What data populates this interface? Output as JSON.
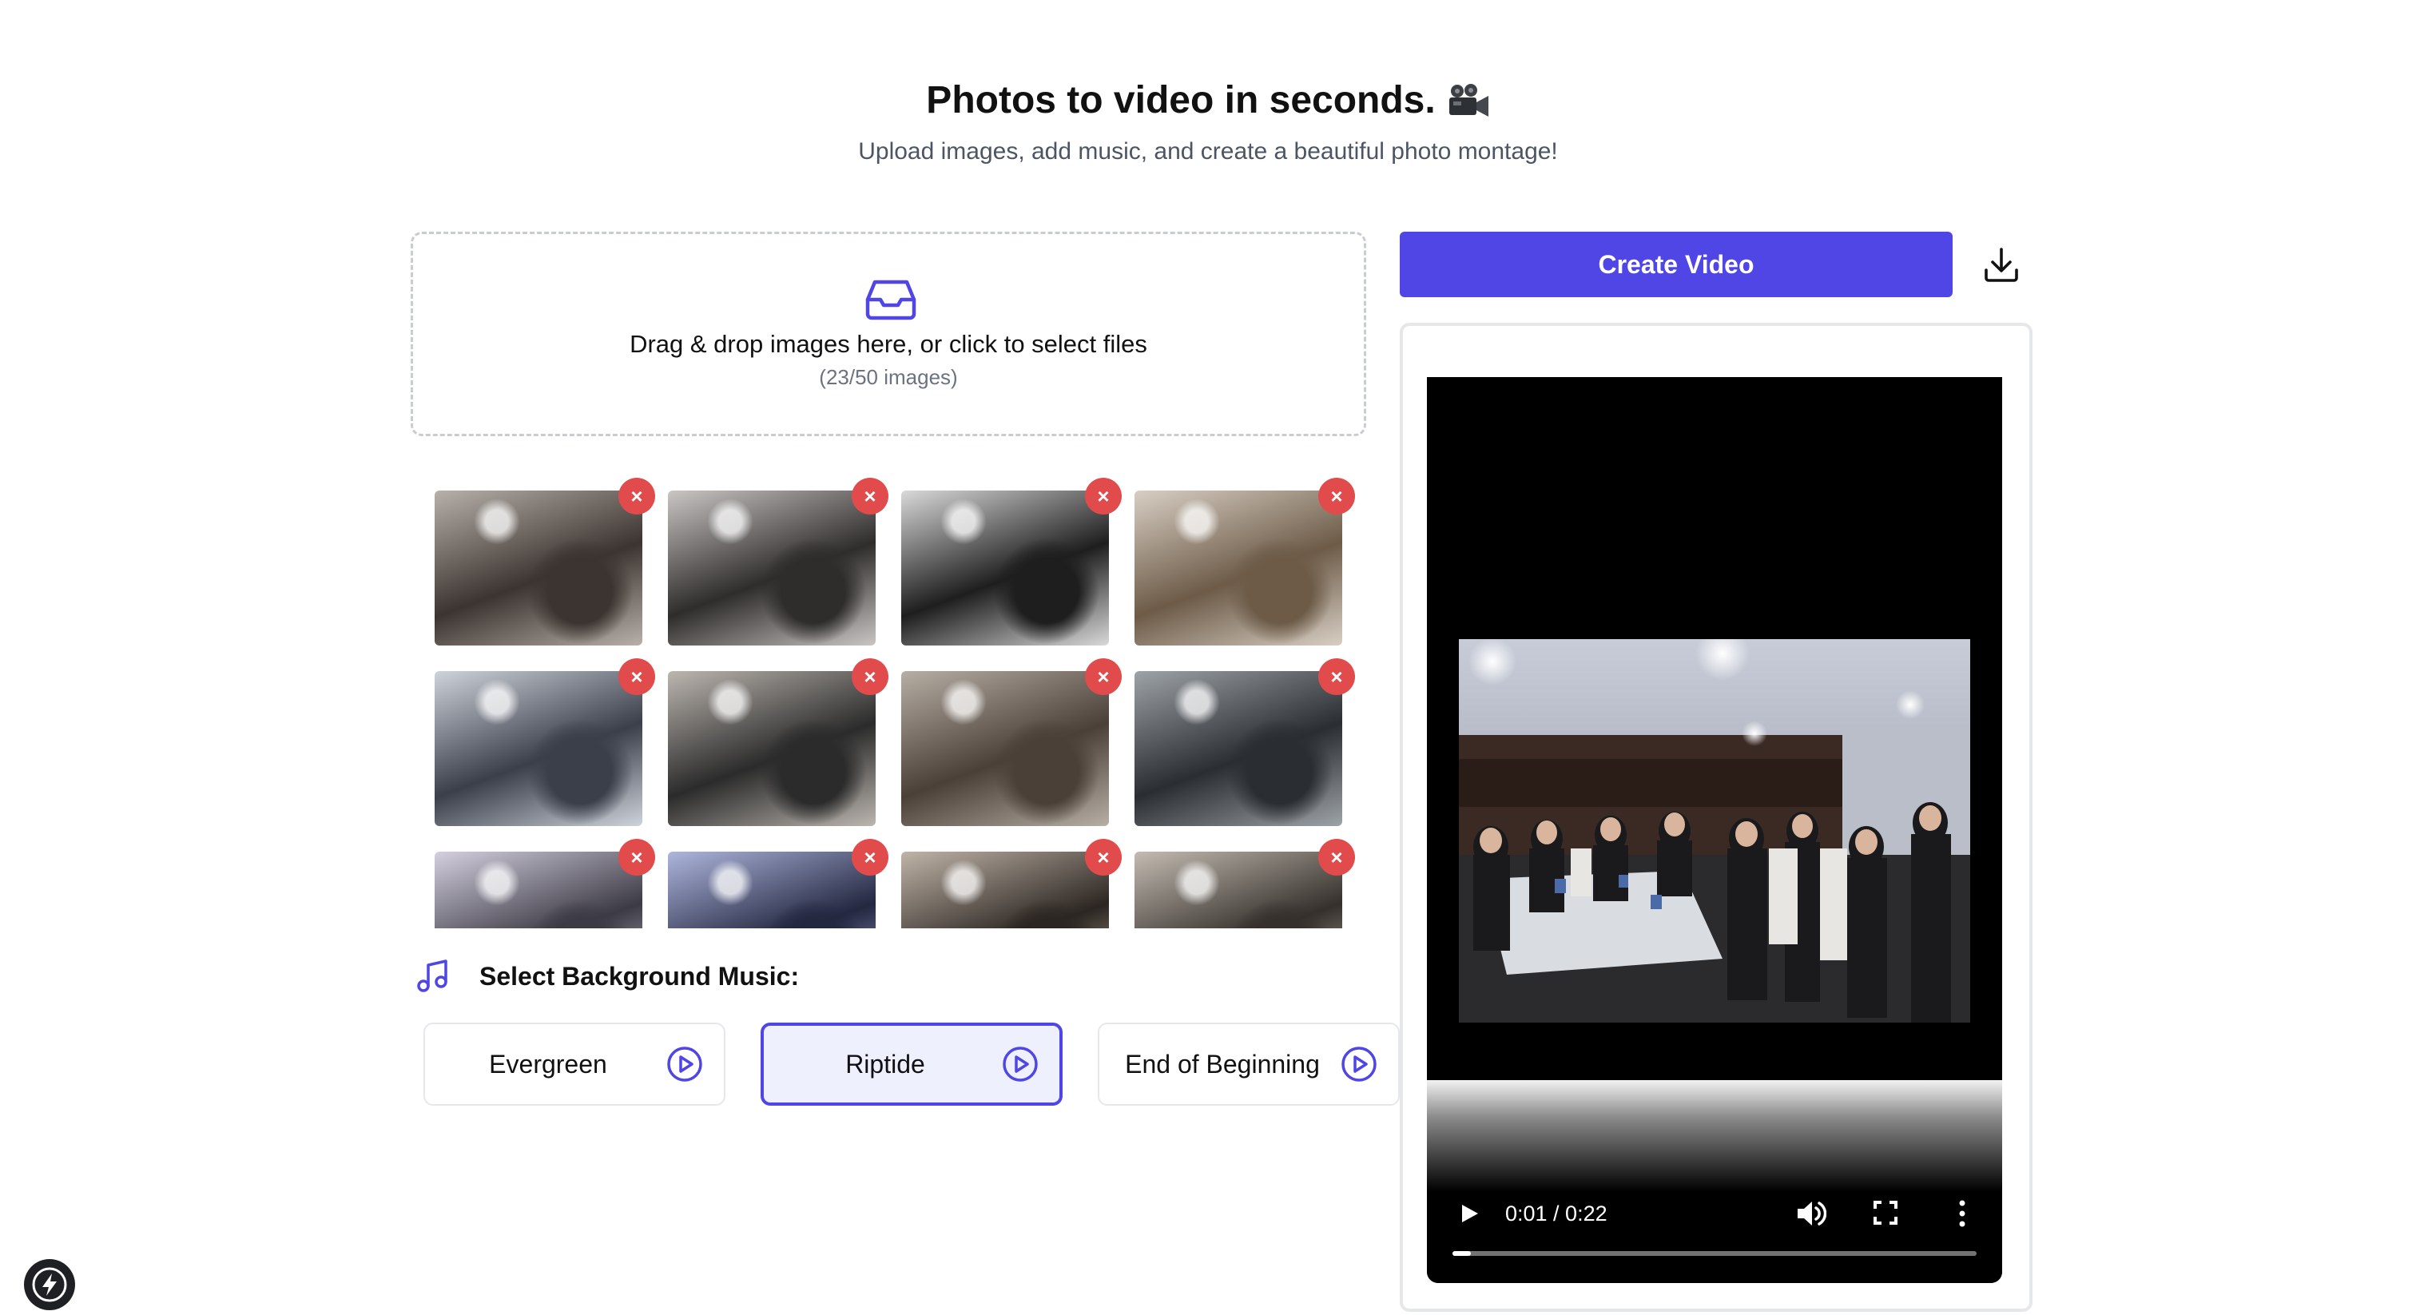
{
  "header": {
    "title": "Photos to video in seconds.",
    "title_icon": "movie-camera-icon",
    "subtitle": "Upload images, add music, and create a beautiful photo montage!"
  },
  "dropzone": {
    "text": "Drag & drop images here, or click to select files",
    "count": "(23/50 images)",
    "icon": "inbox-icon",
    "accent": "#4f46e5"
  },
  "thumbnails": {
    "remove_label": "×",
    "remove_color": "#e24b4b",
    "items": [
      {
        "tone": [
          "#3b3430",
          "#b8b1aa"
        ]
      },
      {
        "tone": [
          "#2f2c2c",
          "#c9c6c4"
        ]
      },
      {
        "tone": [
          "#1e1e1e",
          "#d9d9d9"
        ]
      },
      {
        "tone": [
          "#6d5b48",
          "#d8cfc4"
        ]
      },
      {
        "tone": [
          "#3a3f4a",
          "#cfd3db"
        ]
      },
      {
        "tone": [
          "#2b2b2b",
          "#bcb6b0"
        ]
      },
      {
        "tone": [
          "#4a4038",
          "#b7aea4"
        ]
      },
      {
        "tone": [
          "#2a2d31",
          "#9ea3a8"
        ]
      },
      {
        "tone": [
          "#3c3a44",
          "#d4d0e0"
        ]
      },
      {
        "tone": [
          "#232740",
          "#aeb6dd"
        ]
      },
      {
        "tone": [
          "#2c2622",
          "#c0b4a8"
        ]
      },
      {
        "tone": [
          "#35302c",
          "#c4bcb2"
        ]
      }
    ]
  },
  "music": {
    "label": "Select Background Music:",
    "icon": "music-note-icon",
    "tracks": [
      {
        "name": "Evergreen",
        "selected": false
      },
      {
        "name": "Riptide",
        "selected": true
      },
      {
        "name": "End of Beginning",
        "selected": false
      }
    ]
  },
  "actions": {
    "create_label": "Create Video",
    "download_icon": "download-icon",
    "accent": "#4f46e5"
  },
  "player": {
    "time": "0:01 / 0:22",
    "progress": 0.035,
    "icons": [
      "play-icon",
      "volume-icon",
      "fullscreen-icon",
      "more-options-icon"
    ]
  },
  "dev_badge": {
    "icon": "lightning-bolt-icon"
  }
}
